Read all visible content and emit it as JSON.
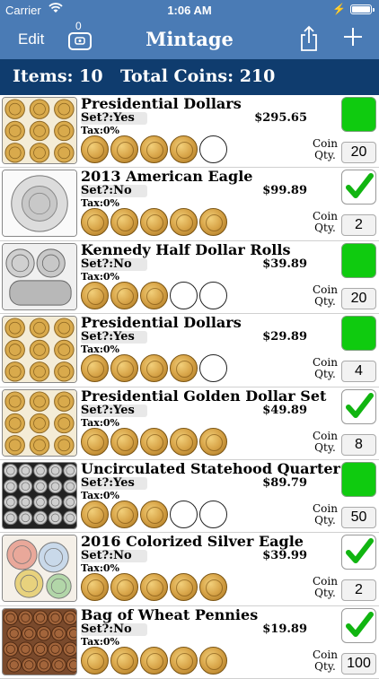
{
  "status_bar": {
    "carrier": "Carrier",
    "time": "1:06 AM"
  },
  "nav": {
    "edit_label": "Edit",
    "title": "Mintage",
    "coin_counter": "0",
    "icons": {
      "coin_counter": "coin-box-icon",
      "share": "share-icon",
      "add": "plus-icon"
    }
  },
  "summary": {
    "items": "Items: 10",
    "total": "Total Coins: 210"
  },
  "labels": {
    "coin_qty_1": "Coin",
    "coin_qty_2": "Qty."
  },
  "colors": {
    "nav": "#4a7bb5",
    "summary": "#0f3c6e",
    "complete_green": "#0fcb0f",
    "check_green": "#11b511",
    "coin_gold": "#d9a64a"
  },
  "rows": [
    {
      "name": "Presidential Dollars",
      "set": "Set?:Yes",
      "tax": "Tax:0%",
      "price": "$295.65",
      "qty": "20",
      "filled": 4,
      "slots": 5,
      "status": "green",
      "thumb": "gold"
    },
    {
      "name": "2013 American Eagle",
      "set": "Set?:No",
      "tax": "Tax:0%",
      "price": "$99.89",
      "qty": "2",
      "filled": 5,
      "slots": 5,
      "status": "check",
      "thumb": "silver"
    },
    {
      "name": "Kennedy Half Dollar Rolls",
      "set": "Set?:No",
      "tax": "Tax:0%",
      "price": "$39.89",
      "qty": "20",
      "filled": 3,
      "slots": 5,
      "status": "green",
      "thumb": "roll"
    },
    {
      "name": "Presidential Dollars",
      "set": "Set?:Yes",
      "tax": "Tax:0%",
      "price": "$29.89",
      "qty": "4",
      "filled": 4,
      "slots": 5,
      "status": "green",
      "thumb": "gold"
    },
    {
      "name": "Presidential Golden Dollar Set",
      "set": "Set?:Yes",
      "tax": "Tax:0%",
      "price": "$49.89",
      "qty": "8",
      "filled": 5,
      "slots": 5,
      "status": "check",
      "thumb": "gold"
    },
    {
      "name": "Uncirculated Statehood Quarter",
      "set": "Set?:Yes",
      "tax": "Tax:0%",
      "price": "$89.79",
      "qty": "50",
      "filled": 3,
      "slots": 5,
      "status": "green",
      "thumb": "quarters"
    },
    {
      "name": "2016 Colorized Silver Eagle",
      "set": "Set?:No",
      "tax": "Tax:0%",
      "price": "$39.99",
      "qty": "2",
      "filled": 5,
      "slots": 5,
      "status": "check",
      "thumb": "color"
    },
    {
      "name": "Bag of Wheat Pennies",
      "set": "Set?:No",
      "tax": "Tax:0%",
      "price": "$19.89",
      "qty": "100",
      "filled": 5,
      "slots": 5,
      "status": "check",
      "thumb": "copper"
    }
  ]
}
